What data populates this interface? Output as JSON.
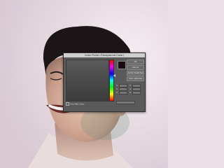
{
  "dialog": {
    "title": "Color Picker (Foreground Color)",
    "buttons": {
      "ok": "OK",
      "cancel": "Cancel",
      "add_to_swatches": "Add to Swatches",
      "color_libraries": "Color Libraries"
    },
    "fields": [
      "H:",
      "S:",
      "B:",
      "R:",
      "G:",
      "B:"
    ],
    "only_web_colors": "Only Web Colors"
  },
  "colors": {
    "swatch_current": "#1a0a12",
    "background_left": "#d6cdd6",
    "background_right": "#efe7ec"
  }
}
